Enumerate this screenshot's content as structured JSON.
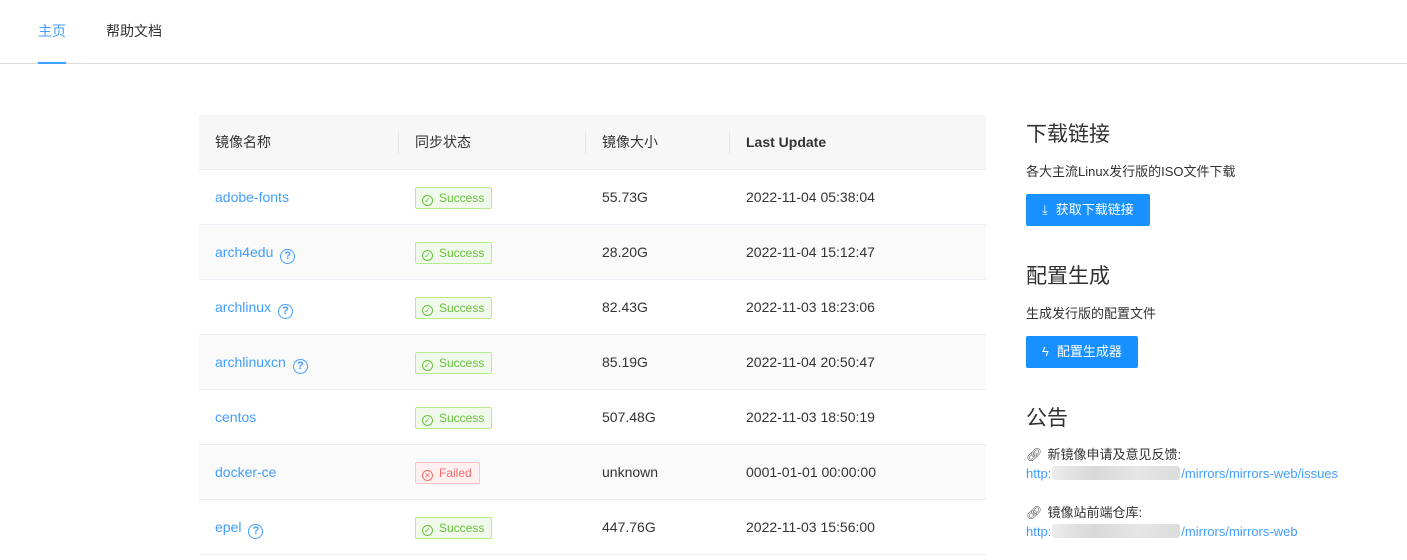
{
  "nav": {
    "tabs": [
      {
        "label": "主页",
        "active": true
      },
      {
        "label": "帮助文档",
        "active": false
      }
    ]
  },
  "table": {
    "headers": [
      "镜像名称",
      "同步状态",
      "镜像大小",
      "Last Update"
    ],
    "rows": [
      {
        "name": "adobe-fonts",
        "help": false,
        "status": "Success",
        "status_type": "success",
        "size": "55.73G",
        "updated": "2022-11-04 05:38:04"
      },
      {
        "name": "arch4edu",
        "help": true,
        "status": "Success",
        "status_type": "success",
        "size": "28.20G",
        "updated": "2022-11-04 15:12:47"
      },
      {
        "name": "archlinux",
        "help": true,
        "status": "Success",
        "status_type": "success",
        "size": "82.43G",
        "updated": "2022-11-03 18:23:06"
      },
      {
        "name": "archlinuxcn",
        "help": true,
        "status": "Success",
        "status_type": "success",
        "size": "85.19G",
        "updated": "2022-11-04 20:50:47"
      },
      {
        "name": "centos",
        "help": false,
        "status": "Success",
        "status_type": "success",
        "size": "507.48G",
        "updated": "2022-11-03 18:50:19"
      },
      {
        "name": "docker-ce",
        "help": false,
        "status": "Failed",
        "status_type": "failed",
        "size": "unknown",
        "updated": "0001-01-01 00:00:00"
      },
      {
        "name": "epel",
        "help": true,
        "status": "Success",
        "status_type": "success",
        "size": "447.76G",
        "updated": "2022-11-03 15:56:00"
      }
    ]
  },
  "sidebar": {
    "download": {
      "title": "下载链接",
      "desc": "各大主流Linux发行版的ISO文件下载",
      "button": "获取下载链接"
    },
    "config": {
      "title": "配置生成",
      "desc": "生成发行版的配置文件",
      "button": "配置生成器"
    },
    "notice": {
      "title": "公告",
      "feedback_label": "新镜像申请及意见反馈:",
      "feedback_url_prefix": "http:",
      "feedback_url_suffix": "/mirrors/mirrors-web/issues",
      "repo_label": "镜像站前端仓库:",
      "repo_url_prefix": "http:",
      "repo_url_suffix": "/mirrors/mirrors-web"
    }
  },
  "colors": {
    "accent": "#409eff",
    "button": "#1890ff",
    "success": "#67c23a",
    "failed": "#f56c6c"
  },
  "icons": {
    "help": "question-circle-icon",
    "success": "check-circle-icon",
    "failed": "close-circle-icon",
    "download": "download-icon",
    "generate": "lightning-icon",
    "link": "link-icon"
  }
}
